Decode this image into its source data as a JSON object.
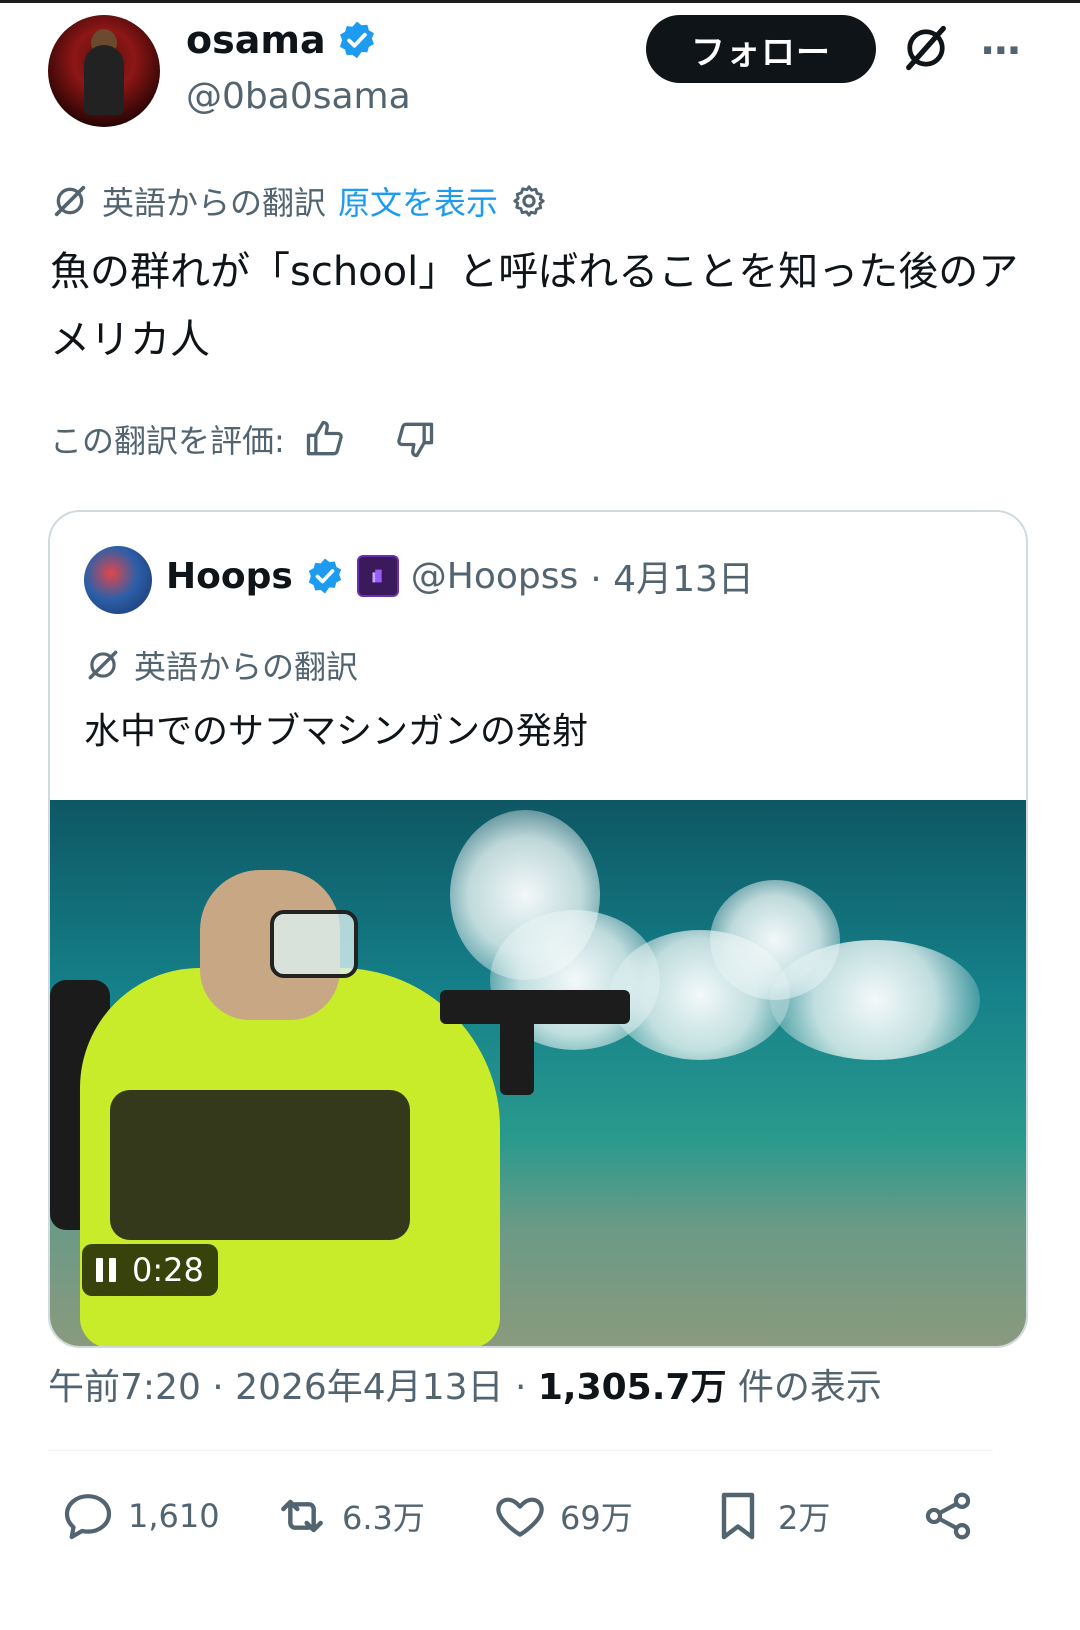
{
  "author": {
    "name": "osama",
    "handle": "@0ba0sama",
    "follow_label": "フォロー",
    "verified_icon": "verified-badge-icon",
    "more_icon": "more-icon"
  },
  "translation": {
    "label": "英語からの翻訳",
    "show_original": "原文を表示"
  },
  "post": {
    "text": "魚の群れが「school」と呼ばれることを知った後のアメリカ人",
    "rate_label": "この翻訳を評価:"
  },
  "quote": {
    "name": "Hoops",
    "handle": "@Hoopss",
    "date": "· 4月13日",
    "translation_label": "英語からの翻訳",
    "text": "水中でのサブマシンガンの発射",
    "video_time": "0:28"
  },
  "meta": {
    "time_date": "午前7:20 · 2026年4月13日 · ",
    "views_count": "1,305.7万",
    "views_label": " 件の表示"
  },
  "actions": {
    "replies": "1,610",
    "reposts": "6.3万",
    "likes": "69万",
    "bookmarks": "2万"
  },
  "colors": {
    "accent": "#1d9bf0",
    "text": "#0f1419",
    "secondary": "#536471",
    "verified": "#1d9bf0"
  }
}
